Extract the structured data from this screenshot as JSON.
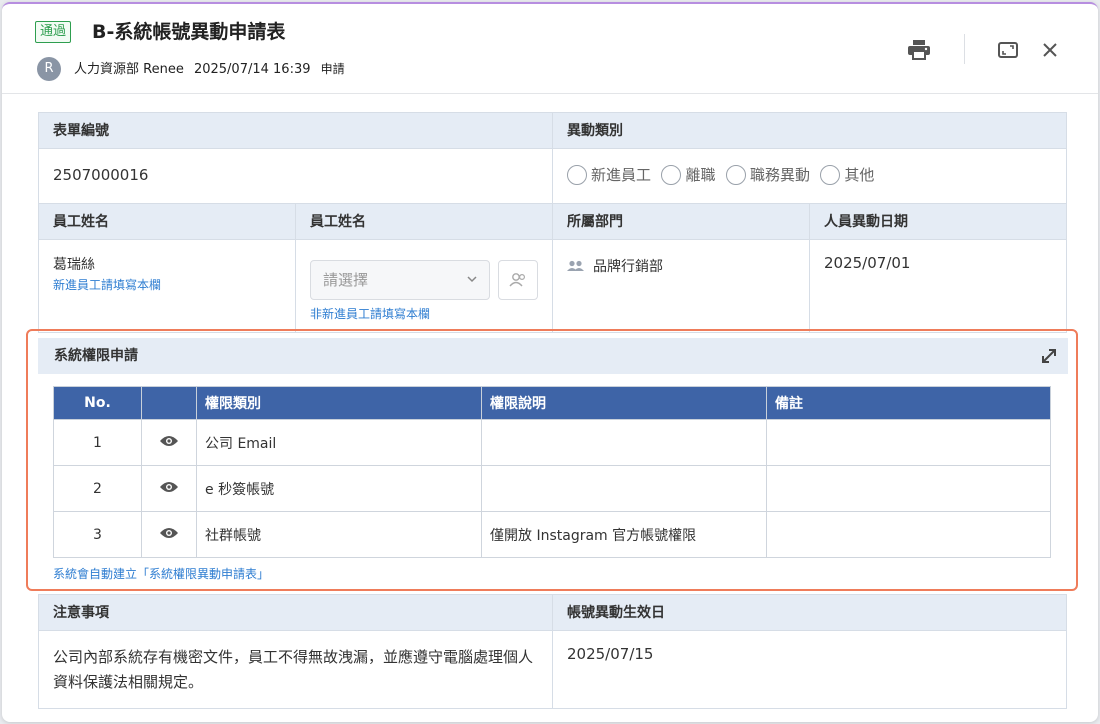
{
  "header": {
    "status_badge": "通過",
    "title": "B-系統帳號異動申請表",
    "avatar_initial": "R",
    "applicant_dept_name": "人力資源部 Renee",
    "applied_at": "2025/07/14 16:39",
    "applied_action": "申請"
  },
  "form": {
    "form_no_label": "表單編號",
    "form_no_value": "2507000016",
    "change_type_label": "異動類別",
    "change_type_options": [
      "新進員工",
      "離職",
      "職務異動",
      "其他"
    ],
    "employee_name_label": "員工姓名",
    "employee_name_value": "葛瑞絲",
    "employee_name_hint": "新進員工請填寫本欄",
    "employee_name2_label": "員工姓名",
    "employee_select_placeholder": "請選擇",
    "employee_name2_hint": "非新進員工請填寫本欄",
    "department_label": "所屬部門",
    "department_value": "品牌行銷部",
    "change_date_label": "人員異動日期",
    "change_date_value": "2025/07/01"
  },
  "permissions": {
    "section_title": "系統權限申請",
    "columns": [
      "No.",
      "",
      "權限類別",
      "權限說明",
      "備註"
    ],
    "rows": [
      {
        "no": "1",
        "type": "公司 Email",
        "desc": "",
        "note": ""
      },
      {
        "no": "2",
        "type": "e 秒簽帳號",
        "desc": "",
        "note": ""
      },
      {
        "no": "3",
        "type": "社群帳號",
        "desc": "僅開放 Instagram 官方帳號權限",
        "note": ""
      }
    ],
    "footer_note": "系統會自動建立「系統權限異動申請表」"
  },
  "notice": {
    "label": "注意事項",
    "text": "公司內部系統存有機密文件，員工不得無故洩漏，並應遵守電腦處理個人資料保護法相關規定。",
    "effective_label": "帳號異動生效日",
    "effective_value": "2025/07/15"
  },
  "colors": {
    "accent": "#3e64a7",
    "label_bg": "#e5ecf5",
    "highlight_border": "#ef7c5a",
    "status_green": "#2e9e4f",
    "link_blue": "#2e7dd1"
  },
  "icons": {
    "print": "print-icon",
    "maximize": "maximize-icon",
    "close": "close-icon",
    "expand": "expand-icon",
    "view": "eye-icon",
    "person": "people-icon",
    "dropdown": "chevron-down-icon"
  }
}
